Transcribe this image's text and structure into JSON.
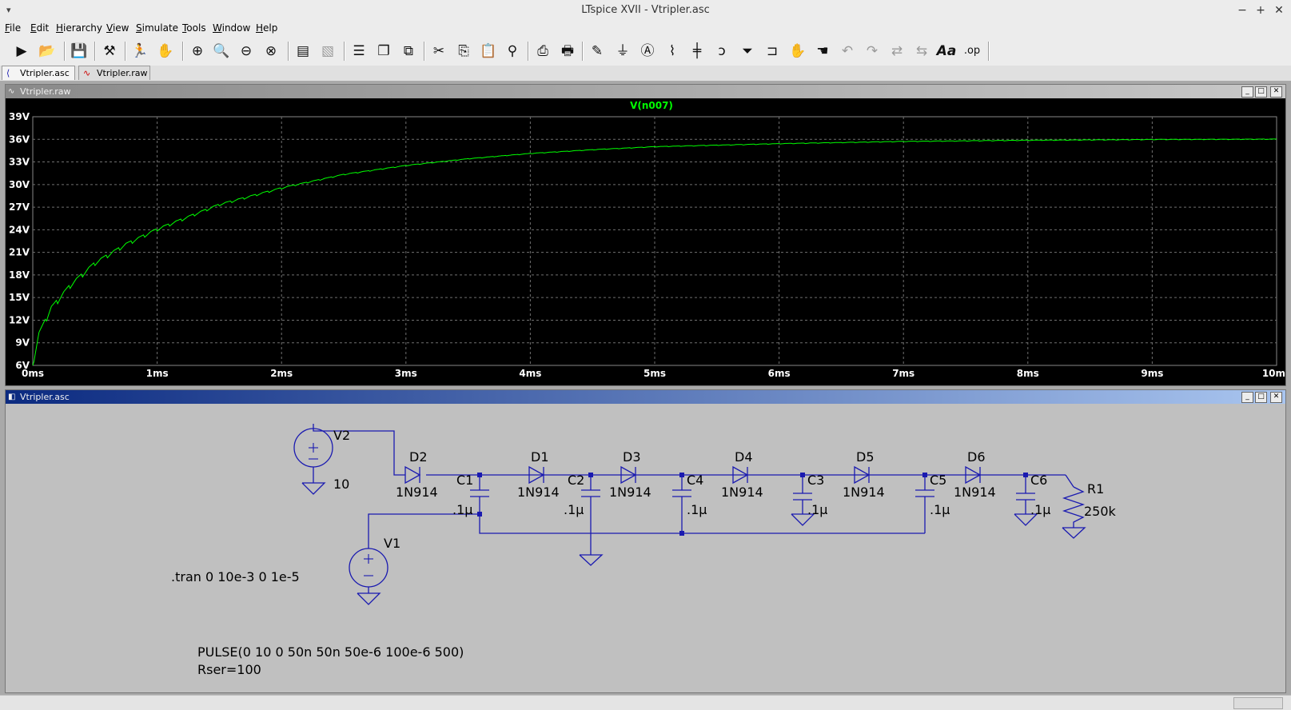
{
  "window": {
    "title": "LTspice XVII - Vtripler.asc",
    "minimize": "−",
    "maximize": "+",
    "close": "✕"
  },
  "menu": [
    "File",
    "Edit",
    "Hierarchy",
    "View",
    "Simulate",
    "Tools",
    "Window",
    "Help"
  ],
  "menu_mnemonics": [
    "F",
    "E",
    "H",
    "V",
    "S",
    "T",
    "W",
    "H"
  ],
  "tabs": [
    {
      "label": "Vtripler.asc"
    },
    {
      "label": "Vtripler.raw"
    }
  ],
  "waveform": {
    "title": "Vtripler.raw",
    "trace_label": "V(n007)",
    "trace_color": "#00ff00"
  },
  "schematic": {
    "title": "Vtripler.asc",
    "wire_color": "#1a1ab0",
    "components": {
      "V2": {
        "name": "V2",
        "value": "10"
      },
      "V1": {
        "name": "V1"
      },
      "D1": {
        "name": "D1",
        "model": "1N914"
      },
      "D2": {
        "name": "D2",
        "model": "1N914"
      },
      "D3": {
        "name": "D3",
        "model": "1N914"
      },
      "D4": {
        "name": "D4",
        "model": "1N914"
      },
      "D5": {
        "name": "D5",
        "model": "1N914"
      },
      "D6": {
        "name": "D6",
        "model": "1N914"
      },
      "C1": {
        "name": "C1",
        "value": ".1µ"
      },
      "C2": {
        "name": "C2",
        "value": ".1µ"
      },
      "C3": {
        "name": "C3",
        "value": ".1µ"
      },
      "C4": {
        "name": "C4",
        "value": ".1µ"
      },
      "C5": {
        "name": "C5",
        "value": ".1µ"
      },
      "C6": {
        "name": "C6",
        "value": ".1µ"
      },
      "R1": {
        "name": "R1",
        "value": "250k"
      }
    },
    "directive": ".tran 0 10e-3 0 1e-5",
    "v1_value_line1": "PULSE(0 10 0 50n 50n 50e-6 100e-6 500)",
    "v1_value_line2": "Rser=100"
  },
  "chart_data": {
    "type": "line",
    "title": "V(n007)",
    "xlabel": "",
    "ylabel": "",
    "x_ticks": [
      "0ms",
      "1ms",
      "2ms",
      "3ms",
      "4ms",
      "5ms",
      "6ms",
      "7ms",
      "8ms",
      "9ms",
      "10ms"
    ],
    "y_ticks": [
      "6V",
      "9V",
      "12V",
      "15V",
      "18V",
      "21V",
      "24V",
      "27V",
      "30V",
      "33V",
      "36V",
      "39V"
    ],
    "xlim_ms": [
      0,
      10
    ],
    "ylim_V": [
      6,
      39
    ],
    "grid": true,
    "series": [
      {
        "name": "V(n007)",
        "x_ms": [
          0,
          0.05,
          0.15,
          0.3,
          0.5,
          0.75,
          1.0,
          1.5,
          2.0,
          2.5,
          3.0,
          3.5,
          4.0,
          4.5,
          5.0,
          6.0,
          7.0,
          8.0,
          9.0,
          10.0
        ],
        "y_V": [
          6,
          10,
          13.5,
          16.5,
          19.5,
          22,
          24,
          27.3,
          29.5,
          31.3,
          32.5,
          33.4,
          34.1,
          34.6,
          35.0,
          35.4,
          35.7,
          35.85,
          35.95,
          36.0
        ]
      }
    ]
  }
}
